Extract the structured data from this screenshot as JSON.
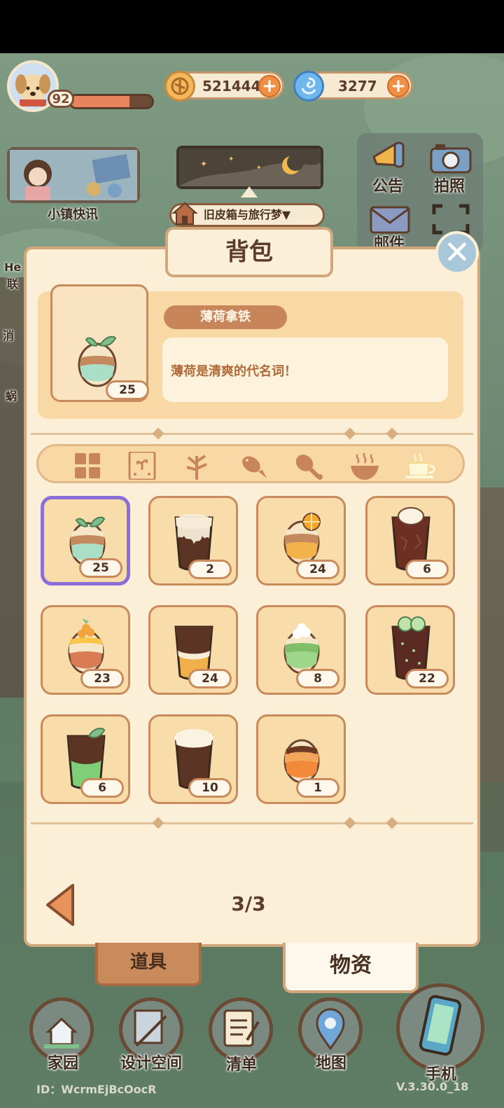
{
  "player": {
    "level": "92",
    "hp_fraction": 0.72
  },
  "currency": {
    "coins": "521444",
    "gems": "3277"
  },
  "left_menu": {
    "news_label": "小镇快讯",
    "side_labels": [
      "He",
      "联",
      "消",
      "蜗"
    ]
  },
  "right_menu": {
    "notice_label": "公告",
    "photo_label": "拍照",
    "mail_label": "邮件"
  },
  "location": {
    "trunk_label": "旧皮箱与旅行梦▼"
  },
  "backpack": {
    "title": "背包",
    "selected": {
      "name": "薄荷拿铁",
      "description": "薄荷是清爽的代名词！",
      "count": "25"
    },
    "categories": [
      "grid-icon",
      "seed-packet-icon",
      "plant-icon",
      "fish-icon",
      "drumstick-icon",
      "hot-bowl-icon",
      "coffee-cup-icon"
    ],
    "active_category": 6,
    "items": [
      {
        "count": "25",
        "kind": "mint-latte",
        "selected": true
      },
      {
        "count": "2",
        "kind": "cream-cola-glass"
      },
      {
        "count": "24",
        "kind": "orange-latte"
      },
      {
        "count": "6",
        "kind": "icecream-float-glass"
      },
      {
        "count": "23",
        "kind": "mango-latte"
      },
      {
        "count": "24",
        "kind": "layered-iced-coffee"
      },
      {
        "count": "8",
        "kind": "matcha-latte"
      },
      {
        "count": "22",
        "kind": "cucumber-soda-glass"
      },
      {
        "count": "6",
        "kind": "mint-mojito-glass"
      },
      {
        "count": "10",
        "kind": "foam-cold-brew-glass"
      },
      {
        "count": "1",
        "kind": "caramel-latte"
      }
    ],
    "page": "3/3",
    "tab_tools": "道具",
    "tab_materials": "物资"
  },
  "bottom_nav": [
    {
      "label": "家园"
    },
    {
      "label": "设计空间"
    },
    {
      "label": "清单"
    },
    {
      "label": "地图"
    },
    {
      "label": "手机"
    }
  ],
  "footer": {
    "id_text": "ID：WcrmEjBcOocR",
    "version": "V.3.30.0_18"
  },
  "colors": {
    "accent": "#c9855a",
    "panel": "#fbefd8",
    "selected_border": "#8a6fd8"
  }
}
